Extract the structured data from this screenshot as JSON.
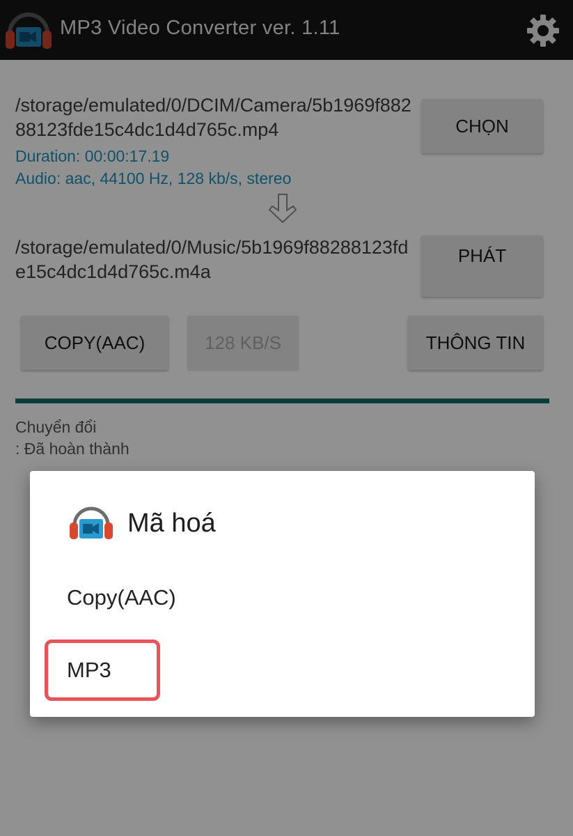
{
  "appbar": {
    "title": "MP3 Video Converter ver. 1.11",
    "logo_icon": "headphones-video-icon",
    "settings_icon": "gear-icon"
  },
  "source": {
    "path": "/storage/emulated/0/DCIM/Camera/5b1969f88288123fde15c4dc1d4d765c.mp4",
    "duration": "Duration: 00:00:17.19",
    "audio": "Audio: aac, 44100 Hz, 128 kb/s,  stereo",
    "choose_button": "CHỌN"
  },
  "arrow_icon": "down-arrow-icon",
  "output": {
    "path": "/storage/emulated/0/Music/5b1969f88288123fde15c4dc1d4d765c.m4a",
    "play_button": "PHÁT"
  },
  "options": {
    "codec_button": "COPY(AAC)",
    "bitrate_button": "128 KB/S",
    "info_button": "THÔNG TIN"
  },
  "progress": {
    "value": 1.0
  },
  "status": {
    "line1": "Chuyển đổi",
    "line2": ": Đã hoàn thành"
  },
  "dialog": {
    "title": "Mã hoá",
    "items": [
      {
        "label": "Copy(AAC)"
      },
      {
        "label": "MP3"
      }
    ],
    "highlighted_item": "MP3"
  },
  "colors": {
    "appbar": "#161616",
    "info_text": "#1b8fb7",
    "progress": "#0b6b63",
    "highlight": "#e8545a"
  }
}
